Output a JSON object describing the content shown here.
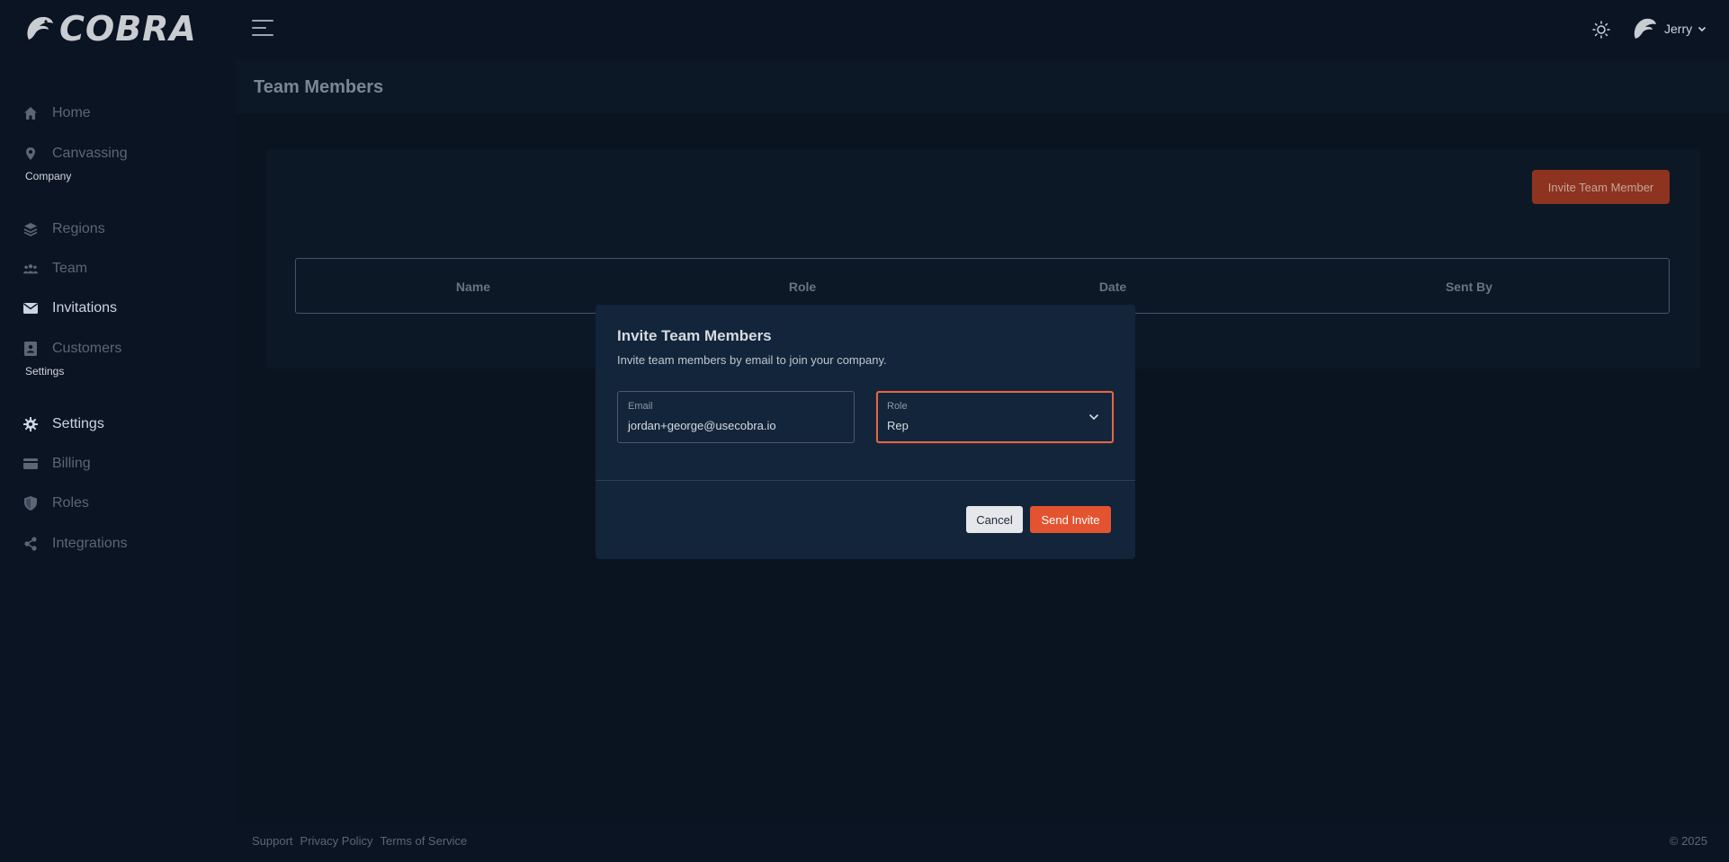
{
  "app": {
    "logo_text": "COBRA"
  },
  "header": {
    "user_name": "Jerry"
  },
  "sidebar": {
    "items": [
      {
        "label": "Home",
        "icon": "home-icon"
      },
      {
        "label": "Canvassing",
        "icon": "map-pin-icon"
      },
      {
        "label": "Regions",
        "icon": "layers-icon"
      },
      {
        "label": "Team",
        "icon": "users-icon"
      },
      {
        "label": "Invitations",
        "icon": "envelope-icon",
        "active": true
      },
      {
        "label": "Customers",
        "icon": "contact-card-icon"
      },
      {
        "label": "Settings",
        "icon": "gear-icon"
      },
      {
        "label": "Billing",
        "icon": "credit-card-icon"
      },
      {
        "label": "Roles",
        "icon": "shield-icon"
      },
      {
        "label": "Integrations",
        "icon": "share-nodes-icon"
      }
    ],
    "sections": {
      "company": "Company",
      "settings": "Settings"
    }
  },
  "page": {
    "title": "Team Members",
    "invite_button": "Invite Team Member",
    "table_headers": [
      "Name",
      "Role",
      "Date",
      "Sent By"
    ]
  },
  "modal": {
    "title": "Invite Team Members",
    "subtitle": "Invite team members by email to join your company.",
    "email_label": "Email",
    "email_value": "jordan+george@usecobra.io",
    "role_label": "Role",
    "role_value": "Rep",
    "cancel_label": "Cancel",
    "send_label": "Send Invite"
  },
  "footer": {
    "links": [
      "Support",
      "Privacy Policy",
      "Terms of Service"
    ],
    "copyright": "© 2025"
  },
  "colors": {
    "background": "#0b1422",
    "accent": "#e4532f",
    "modal": "#12253a"
  }
}
